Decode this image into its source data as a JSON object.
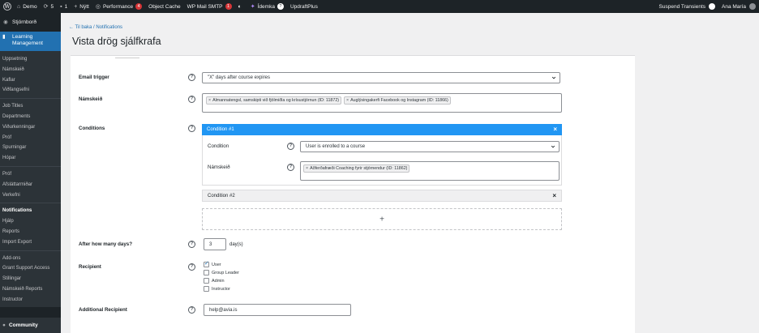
{
  "adminbar": {
    "site": "Demo",
    "updates": "5",
    "comments": "1",
    "new": "Nýtt",
    "performance": "Performance",
    "performance_count": "4",
    "object_cache": "Object Cache",
    "wp_mail": "WP Mail SMTP",
    "wp_mail_count": "1",
    "idemka": "Ídemka",
    "updraft": "UpdraftPlus",
    "suspend": "Suspend Transients",
    "user": "Ana María"
  },
  "sidebar": {
    "dashboard": "Stjórnborð",
    "active": "Learning Management",
    "items": [
      "Uppsetning",
      "Námskeið",
      "Kaflar",
      "Viðfangsefni",
      "Job Titles",
      "Departments",
      "Viðurkenningar",
      "Próf",
      "Spurningar",
      "Hópar",
      "Próf",
      "Afsláttarmiðar",
      "Verkefni",
      "Notifications",
      "Hjálp",
      "Reports",
      "Import Export",
      "Add-ons",
      "Grant Support Access",
      "Stillingar",
      "Námskeið Reports",
      "Instructor"
    ],
    "current": "Notifications",
    "community": "Community"
  },
  "header": {
    "back": "← Til baka / Notifications",
    "title": "Vista drög sjálfkrafa"
  },
  "form": {
    "email_trigger_label": "Email trigger",
    "email_trigger_value": "\"X\" days after course expires",
    "course_label": "Námskeið",
    "course_tags": [
      "Almannatengsl, samskipti við fjölmiðla og krísustjórnun (ID: 11872)",
      "Auglýsingakerfi Facebook og Instagram (ID: 11866)"
    ],
    "conditions_label": "Conditions",
    "condition1_title": "Condition #1",
    "condition_label": "Condition",
    "condition_value": "User is enrolled to a course",
    "cond_course_label": "Námskeið",
    "cond_course_tag": "Aðferðafræði Coaching fyrir stjórnendur (ID: 11862)",
    "condition2_title": "Condition #2",
    "add_symbol": "+",
    "days_label": "After how many days?",
    "days_value": "3",
    "days_unit": "day(s)",
    "recipient_label": "Recipient",
    "recipients": [
      {
        "label": "User",
        "checked": true
      },
      {
        "label": "Group Leader",
        "checked": false
      },
      {
        "label": "Admin",
        "checked": false
      },
      {
        "label": "Instructor",
        "checked": false
      }
    ],
    "additional_label": "Additional Recipient",
    "additional_value": "help@avia.is",
    "help_symbol": "?",
    "close_symbol": "×",
    "tag_remove": "×"
  },
  "colors": {
    "accent": "#2271b1",
    "condition_header": "#2196f3",
    "adminbar": "#1d2327"
  }
}
